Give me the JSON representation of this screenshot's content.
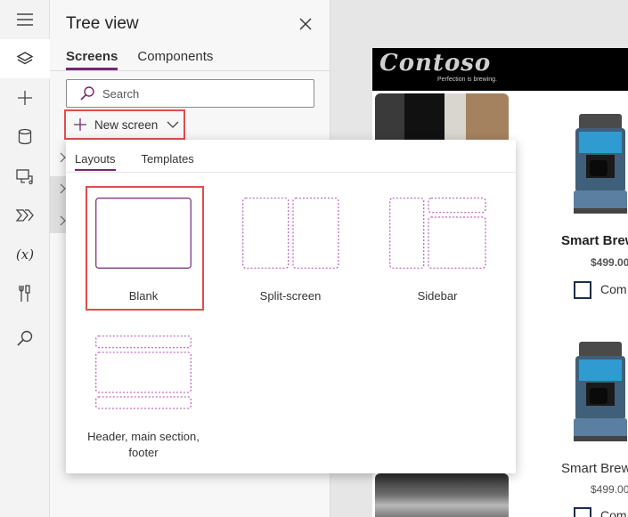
{
  "rail": {
    "items": [
      {
        "icon": "hamburger-menu-icon"
      },
      {
        "icon": "layers-icon",
        "active": true
      },
      {
        "icon": "plus-icon"
      },
      {
        "icon": "database-icon"
      },
      {
        "icon": "media-icon"
      },
      {
        "icon": "power-automate-icon"
      },
      {
        "icon": "variables-icon",
        "text": "(x)"
      },
      {
        "icon": "tools-icon"
      },
      {
        "icon": "search-icon"
      }
    ]
  },
  "tree_view": {
    "title": "Tree view",
    "tabs": [
      {
        "label": "Screens",
        "active": true
      },
      {
        "label": "Components",
        "active": false
      }
    ],
    "search": {
      "placeholder": "Search"
    },
    "new_screen": {
      "label": "New screen"
    }
  },
  "flyout": {
    "tabs": [
      {
        "label": "Layouts",
        "active": true
      },
      {
        "label": "Templates",
        "active": false
      }
    ],
    "layouts": [
      {
        "label": "Blank",
        "selected": true
      },
      {
        "label": "Split-screen"
      },
      {
        "label": "Sidebar"
      },
      {
        "label": "Header, main section, footer"
      }
    ]
  },
  "app_preview": {
    "logo": "Contoso",
    "tagline": "Perfection is brewing.",
    "products": [
      {
        "name": "Smart Brew",
        "price": "$499.00",
        "checkbox_label": "Com"
      },
      {
        "name": "Smart Brew",
        "price": "$499.00",
        "checkbox_label": "Com"
      }
    ]
  },
  "colors": {
    "accent": "#742774",
    "highlight": "#e34c4c",
    "panel_bg": "#f7f7f7",
    "rail_bg": "#f3f3f3",
    "canvas_bg": "#e6e6e6"
  }
}
